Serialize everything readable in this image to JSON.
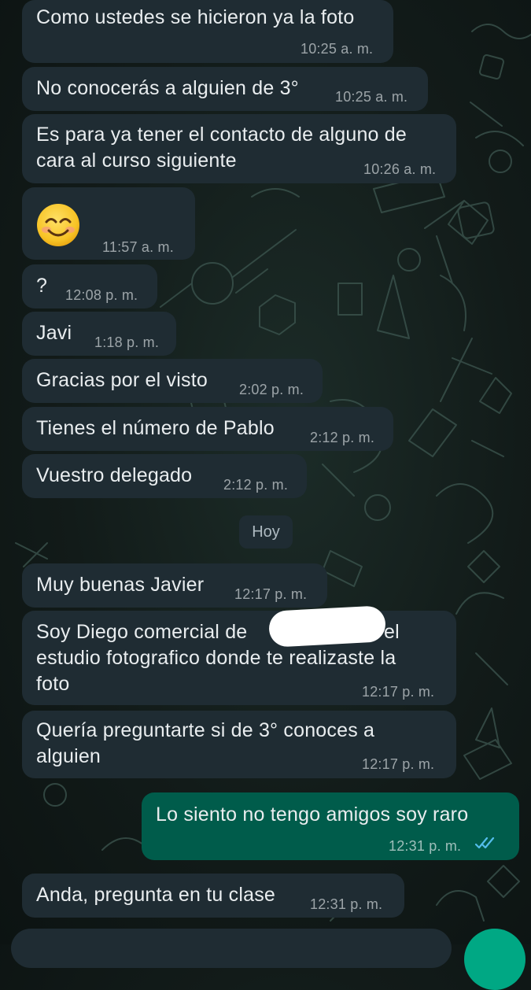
{
  "messages": [
    {
      "id": "m1",
      "direction": "in",
      "lines": [
        "Como ustedes se hicieron ya la foto"
      ],
      "time": "10:25 a. m."
    },
    {
      "id": "m2",
      "direction": "in",
      "lines": [
        "No conocerás a alguien de 3°"
      ],
      "time": "10:25 a. m."
    },
    {
      "id": "m3",
      "direction": "in",
      "lines": [
        "Es para ya tener el contacto de alguno de",
        "cara al curso siguiente"
      ],
      "time": "10:26 a. m."
    },
    {
      "id": "m4",
      "direction": "in",
      "emoji": "smiling-face-icon",
      "time": "11:57 a. m."
    },
    {
      "id": "m5",
      "direction": "in",
      "lines": [
        "?"
      ],
      "time": "12:08 p. m."
    },
    {
      "id": "m6",
      "direction": "in",
      "lines": [
        "Javi"
      ],
      "time": "1:18 p. m."
    },
    {
      "id": "m7",
      "direction": "in",
      "lines": [
        "Gracias por el visto"
      ],
      "time": "2:02 p. m."
    },
    {
      "id": "m8",
      "direction": "in",
      "lines": [
        "Tienes el número de Pablo"
      ],
      "time": "2:12 p. m."
    },
    {
      "id": "m9",
      "direction": "in",
      "lines": [
        "Vuestro delegado"
      ],
      "time": "2:12 p. m."
    },
    {
      "id": "m10",
      "direction": "in",
      "lines": [
        "Muy buenas Javier"
      ],
      "time": "12:17 p. m."
    },
    {
      "id": "m11",
      "direction": "in",
      "lines": [
        "Soy Diego comercial de",
        "el",
        "estudio fotografico donde te realizaste la",
        "foto"
      ],
      "time": "12:17 p. m."
    },
    {
      "id": "m12",
      "direction": "in",
      "lines": [
        "Quería preguntarte si de 3° conoces a",
        "alguien"
      ],
      "time": "12:17 p. m."
    },
    {
      "id": "m13",
      "direction": "out",
      "lines": [
        "Lo siento no tengo amigos soy raro"
      ],
      "time": "12:31 p. m.",
      "status": "read"
    },
    {
      "id": "m14",
      "direction": "in",
      "lines": [
        "Anda, pregunta en tu clase"
      ],
      "time": "12:31 p. m."
    }
  ],
  "date_separator": "Hoy",
  "colors": {
    "incoming_bubble": "#1f2c33",
    "outgoing_bubble": "#005c4b",
    "read_ticks": "#53bdeb",
    "text": "#e9edef",
    "accent": "#00a884"
  }
}
